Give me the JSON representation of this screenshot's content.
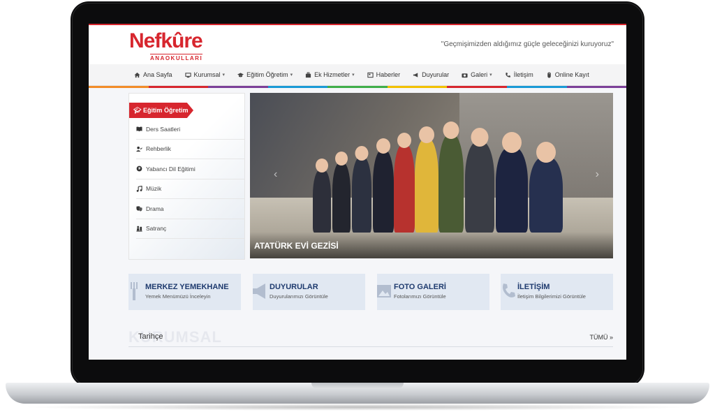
{
  "header": {
    "logo_text": "Nefkûre",
    "logo_sub": "ANAOKULLARI",
    "slogan": "\"Geçmişimizden aldığımız güçle geleceğinizi kuruyoruz\""
  },
  "nav": {
    "items": [
      {
        "label": "Ana Sayfa",
        "icon": "home-icon"
      },
      {
        "label": "Kurumsal",
        "icon": "institution-icon"
      },
      {
        "label": "Eğitim Öğretim",
        "icon": "graduation-cap-icon"
      },
      {
        "label": "Ek Hizmetler",
        "icon": "services-icon"
      },
      {
        "label": "Haberler",
        "icon": "newspaper-icon"
      },
      {
        "label": "Duyurular",
        "icon": "megaphone-icon"
      },
      {
        "label": "Galeri",
        "icon": "camera-icon"
      },
      {
        "label": "İletişim",
        "icon": "phone-icon"
      },
      {
        "label": "Online Kayıt",
        "icon": "mouse-icon"
      }
    ],
    "color_bar": [
      "#f28c28",
      "#d7262e",
      "#7c3f98",
      "#1a9ad6",
      "#3fae49",
      "#f2c100",
      "#d7262e",
      "#1a9ad6",
      "#7c3f98"
    ]
  },
  "sidebar": {
    "heading": "Eğitim Öğretim",
    "items": [
      {
        "label": "Ders Saatleri",
        "icon": "book-icon"
      },
      {
        "label": "Rehberlik",
        "icon": "user-check-icon"
      },
      {
        "label": "Yabancı Dil Eğitimi",
        "icon": "globe-icon"
      },
      {
        "label": "Müzik",
        "icon": "music-icon"
      },
      {
        "label": "Drama",
        "icon": "masks-icon"
      },
      {
        "label": "Satranç",
        "icon": "chess-icon"
      }
    ]
  },
  "slider": {
    "caption": "ATATÜRK EVİ GEZİSİ"
  },
  "boxes": [
    {
      "title": "MERKEZ YEMEKHANE",
      "subtitle": "Yemek Menümüzü İnceleyin",
      "icon": "utensils-icon"
    },
    {
      "title": "DUYURULAR",
      "subtitle": "Duyurularımızı Görüntüle",
      "icon": "megaphone-icon"
    },
    {
      "title": "FOTO GALERİ",
      "subtitle": "Fotolarımızı Görüntüle",
      "icon": "image-icon"
    },
    {
      "title": "İLETİŞİM",
      "subtitle": "İletişim Bilgilerimizi Görüntüle",
      "icon": "phone-icon"
    }
  ],
  "section": {
    "watermark": "KURUMSAL",
    "tab": "Tarihçe",
    "all_link": "TÜMÜ »"
  },
  "colors": {
    "brand_red": "#d7262e",
    "brand_blue": "#1a9ad6",
    "box_bg": "#e1e8f2",
    "box_title": "#1e3a6e"
  }
}
